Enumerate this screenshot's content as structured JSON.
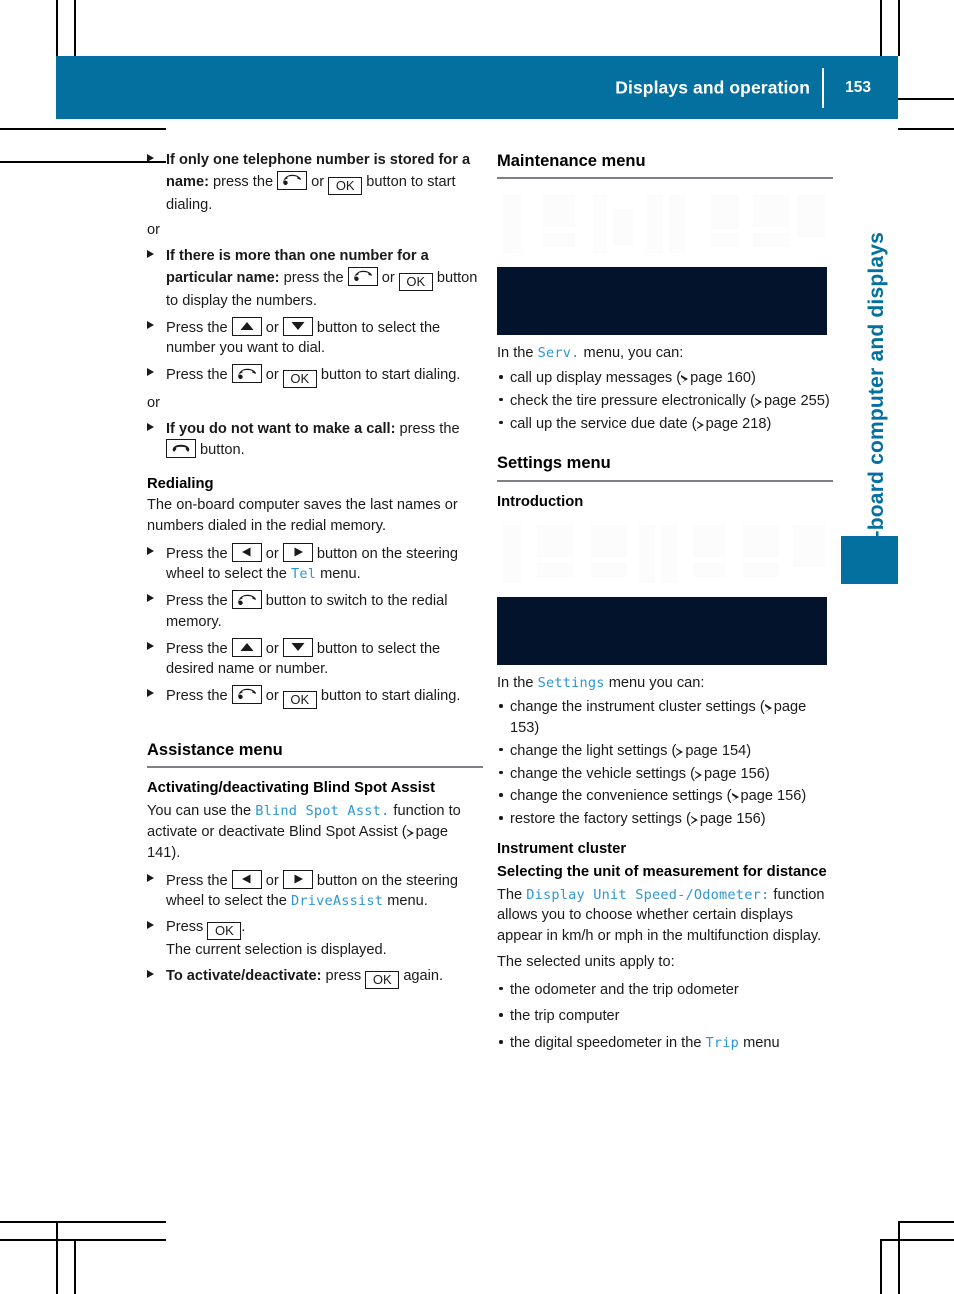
{
  "page": {
    "header_title": "Displays and operation",
    "page_number": "153",
    "side_tab_text": "On-board computer and displays",
    "accent_color": "#0470a0",
    "display_text_color": "#2e97d4",
    "rule_color": "#7d8185",
    "figure_color": "#02132b"
  },
  "left_column": {
    "steps": [
      {
        "bold": "If only one telephone number is stored for a name:",
        "rest_1": " press the ",
        "icon_1": "phone-receiver-icon",
        "mid_1": " or ",
        "key_1": "OK",
        "rest_2": " button to start dialing."
      },
      {
        "bold": "If there is more than one number for a particular name:",
        "rest_1": " press the ",
        "icon_1": "phone-receiver-icon",
        "mid_1": " or ",
        "key_1": "OK",
        "rest_2": " button to display the numbers."
      },
      {
        "pre": "Press the ",
        "key_1": "arrow-up-icon",
        "mid": " or ",
        "key_2": "arrow-down-icon",
        "post": " button to select the number you want to dial."
      },
      {
        "pre": "Press the ",
        "icon_1": "phone-receiver-icon",
        "mid": " or ",
        "key_1": "OK",
        "post": " button to start dialing."
      },
      {
        "bold": "If you do not want to make a call:",
        "rest_1": " press the ",
        "icon_1": "phone-hangup-icon",
        "rest_2": " button."
      }
    ],
    "or_label": "or",
    "redialing": {
      "heading": "Redialing",
      "intro": "The on-board computer saves the last names or numbers dialed in the redial memory.",
      "steps": [
        {
          "pre": "Press the ",
          "key_1": "arrow-left-icon",
          "mid": " or ",
          "key_2": "arrow-right-icon",
          "post_1": " button on the steering wheel to select the ",
          "mono": "Tel",
          "post_2": " menu."
        },
        {
          "pre": "Press the ",
          "icon_1": "phone-receiver-icon",
          "post": " button to switch to the redial memory."
        },
        {
          "pre": "Press the ",
          "key_1": "arrow-up-icon",
          "mid": " or ",
          "key_2": "arrow-down-icon",
          "post": " button to select the desired name or number."
        },
        {
          "pre": "Press the ",
          "icon_1": "phone-receiver-icon",
          "mid": " or ",
          "key_1": "OK",
          "post": " button to start dialing."
        }
      ]
    },
    "assistance_menu": {
      "heading": "Assistance menu",
      "subheading": "Activating/deactivating Blind Spot Assist",
      "intro_1": "You can use the ",
      "intro_mono": "Blind Spot Asst.",
      "intro_2": " function to activate or deactivate Blind Spot Assist (",
      "intro_ref": "page 141",
      "intro_3": ").",
      "steps": [
        {
          "pre": "Press the ",
          "key_1": "arrow-left-icon",
          "mid": " or ",
          "key_2": "arrow-right-icon",
          "post_1": " button on the steering wheel to select the ",
          "mono": "DriveAssist",
          "post_2": " menu."
        },
        {
          "pre": "Press ",
          "key_1": "OK",
          "post": ".",
          "note": "The current selection is displayed."
        },
        {
          "bold": "To activate/deactivate:",
          "rest_1": " press ",
          "key_1": "OK",
          "rest_2": " again."
        }
      ]
    }
  },
  "right_column": {
    "maintenance_menu": {
      "heading": "Maintenance menu",
      "figure_alt": "serv-menu-display-figure",
      "intro_1": "In the ",
      "intro_mono": "Serv.",
      "intro_2": " menu, you can:",
      "bullets": [
        {
          "text_1": "call up display messages (",
          "ref": "page 160",
          "text_2": ")"
        },
        {
          "text_1": "check the tire pressure electronically (",
          "ref": "page 255",
          "text_2": ")"
        },
        {
          "text_1": "call up the service due date (",
          "ref": "page 218",
          "text_2": ")"
        }
      ]
    },
    "settings_menu": {
      "heading": "Settings menu",
      "subheading": "Introduction",
      "figure_alt": "settings-menu-display-figure",
      "intro_1": "In the ",
      "intro_mono": "Settings",
      "intro_2": " menu you can:",
      "bullets": [
        {
          "text_1": "change the instrument cluster settings (",
          "ref": "page 153",
          "text_2": ")"
        },
        {
          "text_1": "change the light settings (",
          "ref": "page 154",
          "text_2": ")"
        },
        {
          "text_1": "change the vehicle settings (",
          "ref": "page 156",
          "text_2": ")"
        },
        {
          "text_1": "change the convenience settings (",
          "ref": "page 156",
          "text_2": ")"
        },
        {
          "text_1": "restore the factory settings (",
          "ref": "page 156",
          "text_2": ")"
        }
      ],
      "instrument_cluster": {
        "heading": "Instrument cluster",
        "subheading": "Selecting the unit of measurement for distance",
        "body_1": "The ",
        "body_mono": "Display Unit Speed-/Odometer:",
        "body_2": " function allows you to choose whether certain displays appear in km/h or mph in the multifunction display.",
        "apply_intro": "The selected units apply to:",
        "bullets": [
          {
            "text": "the odometer and the trip odometer"
          },
          {
            "text": "the trip computer"
          },
          {
            "text_1": "the digital speedometer in the ",
            "mono": "Trip",
            "text_2": " menu"
          }
        ]
      }
    }
  }
}
